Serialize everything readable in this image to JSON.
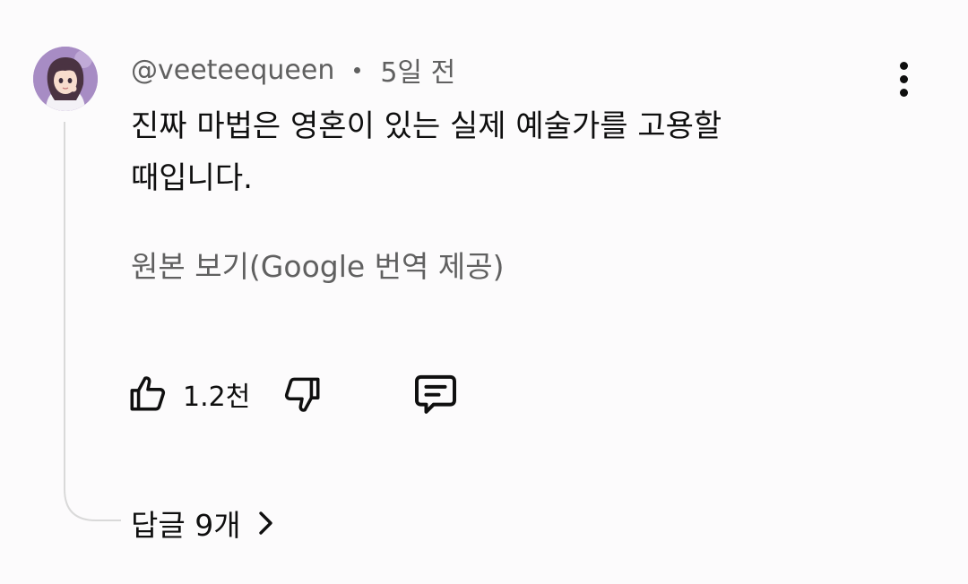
{
  "comment": {
    "author": "@veeteequeen",
    "time": "5일 전",
    "text_lines": [
      "진짜 마법은 영혼이 있는 실제 예술가를 고용할",
      "때입니다."
    ],
    "translation_link": "원본 보기(Google 번역 제공)",
    "like_count": "1.2천",
    "replies_label": "답글 9개",
    "avatar_icon": "anime-girl-avatar",
    "more_icon": "vertical-dots-icon"
  },
  "colors": {
    "background": "#fcfbfc",
    "primary_text": "#0f0f0f",
    "secondary_text": "#606060",
    "thread_line": "#d9d9d9",
    "avatar_bg": "#b59ad0"
  }
}
